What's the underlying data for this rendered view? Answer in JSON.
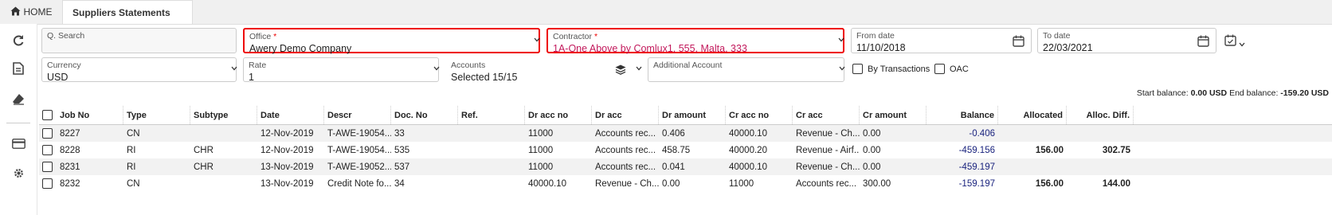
{
  "tabs": {
    "home_label": "HOME",
    "active_label": "Suppliers Statements"
  },
  "filters": {
    "search_placeholder": "Q. Search",
    "office": {
      "label": "Office",
      "value": "Awery Demo Company"
    },
    "contractor": {
      "label": "Contractor",
      "value": "1A-One Above by Comlux1, 555, Malta, 333"
    },
    "from_date": {
      "label": "From date",
      "value": "11/10/2018"
    },
    "to_date": {
      "label": "To date",
      "value": "22/03/2021"
    },
    "currency": {
      "label": "Currency",
      "value": "USD"
    },
    "rate": {
      "label": "Rate",
      "value": "1"
    },
    "accounts": {
      "label": "Accounts",
      "value": "Selected 15/15"
    },
    "additional_account": {
      "label": "Additional Account",
      "value": ""
    },
    "by_transactions_label": "By Transactions",
    "oac_label": "OAC",
    "required_mark": "*"
  },
  "balance": {
    "start_label": "Start balance:",
    "start_value": "0.00 USD",
    "end_label": "End balance:",
    "end_value": "-159.20 USD"
  },
  "table": {
    "columns": [
      "Job No",
      "Type",
      "Subtype",
      "Date",
      "Descr",
      "Doc. No",
      "Ref.",
      "Dr acc no",
      "Dr acc",
      "Dr amount",
      "Cr acc no",
      "Cr acc",
      "Cr amount",
      "Balance",
      "Allocated",
      "Alloc. Diff."
    ],
    "rows": [
      [
        "8227",
        "CN",
        "",
        "12-Nov-2019",
        "T-AWE-19054...",
        "33",
        "",
        "11000",
        "Accounts rec...",
        "0.406",
        "40000.10",
        "Revenue - Ch...",
        "0.00",
        "-0.406",
        "",
        ""
      ],
      [
        "8228",
        "RI",
        "CHR",
        "12-Nov-2019",
        "T-AWE-19054...",
        "535",
        "",
        "11000",
        "Accounts rec...",
        "458.75",
        "40000.20",
        "Revenue - Airf...",
        "0.00",
        "-459.156",
        "156.00",
        "302.75"
      ],
      [
        "8231",
        "RI",
        "CHR",
        "13-Nov-2019",
        "T-AWE-19052...",
        "537",
        "",
        "11000",
        "Accounts rec...",
        "0.041",
        "40000.10",
        "Revenue - Ch...",
        "0.00",
        "-459.197",
        "",
        ""
      ],
      [
        "8232",
        "CN",
        "",
        "13-Nov-2019",
        "Credit Note fo...",
        "34",
        "",
        "40000.10",
        "Revenue - Ch...",
        "0.00",
        "11000",
        "Accounts rec...",
        "300.00",
        "-159.197",
        "156.00",
        "144.00"
      ]
    ]
  },
  "colors": {
    "required_border": "#e00000",
    "contractor_text": "#c2185b",
    "balance_text": "#1a237e"
  }
}
